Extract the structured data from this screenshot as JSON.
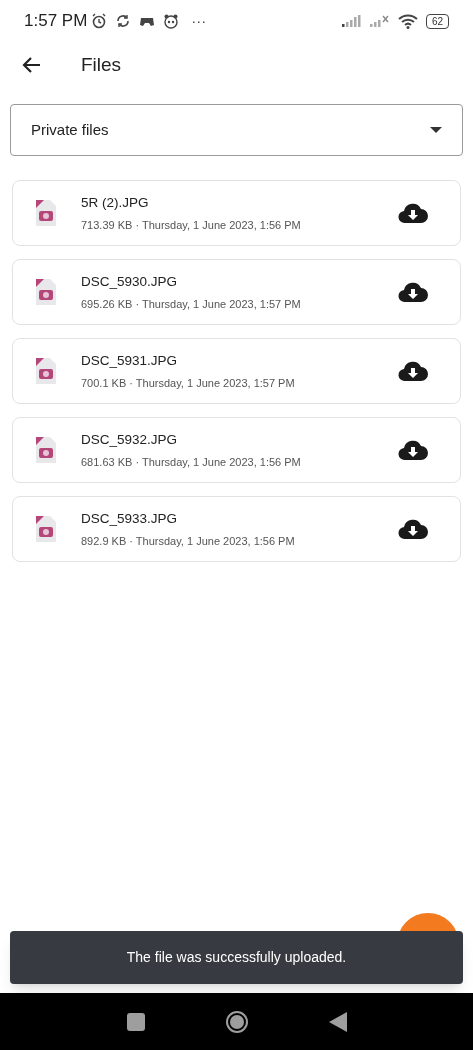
{
  "status_bar": {
    "time": "1:57 PM",
    "more": "···",
    "battery": "62"
  },
  "header": {
    "title": "Files"
  },
  "folder_select": {
    "value": "Private files"
  },
  "files": [
    {
      "name": "5R (2).JPG",
      "details": "713.39 KB · Thursday, 1 June 2023, 1:56 PM"
    },
    {
      "name": "DSC_5930.JPG",
      "details": "695.26 KB · Thursday, 1 June 2023, 1:57 PM"
    },
    {
      "name": "DSC_5931.JPG",
      "details": "700.1 KB · Thursday, 1 June 2023, 1:57 PM"
    },
    {
      "name": "DSC_5932.JPG",
      "details": "681.63 KB · Thursday, 1 June 2023, 1:56 PM"
    },
    {
      "name": "DSC_5933.JPG",
      "details": "892.9 KB · Thursday, 1 June 2023, 1:56 PM"
    }
  ],
  "snackbar": {
    "message": "The file was successfully uploaded."
  }
}
